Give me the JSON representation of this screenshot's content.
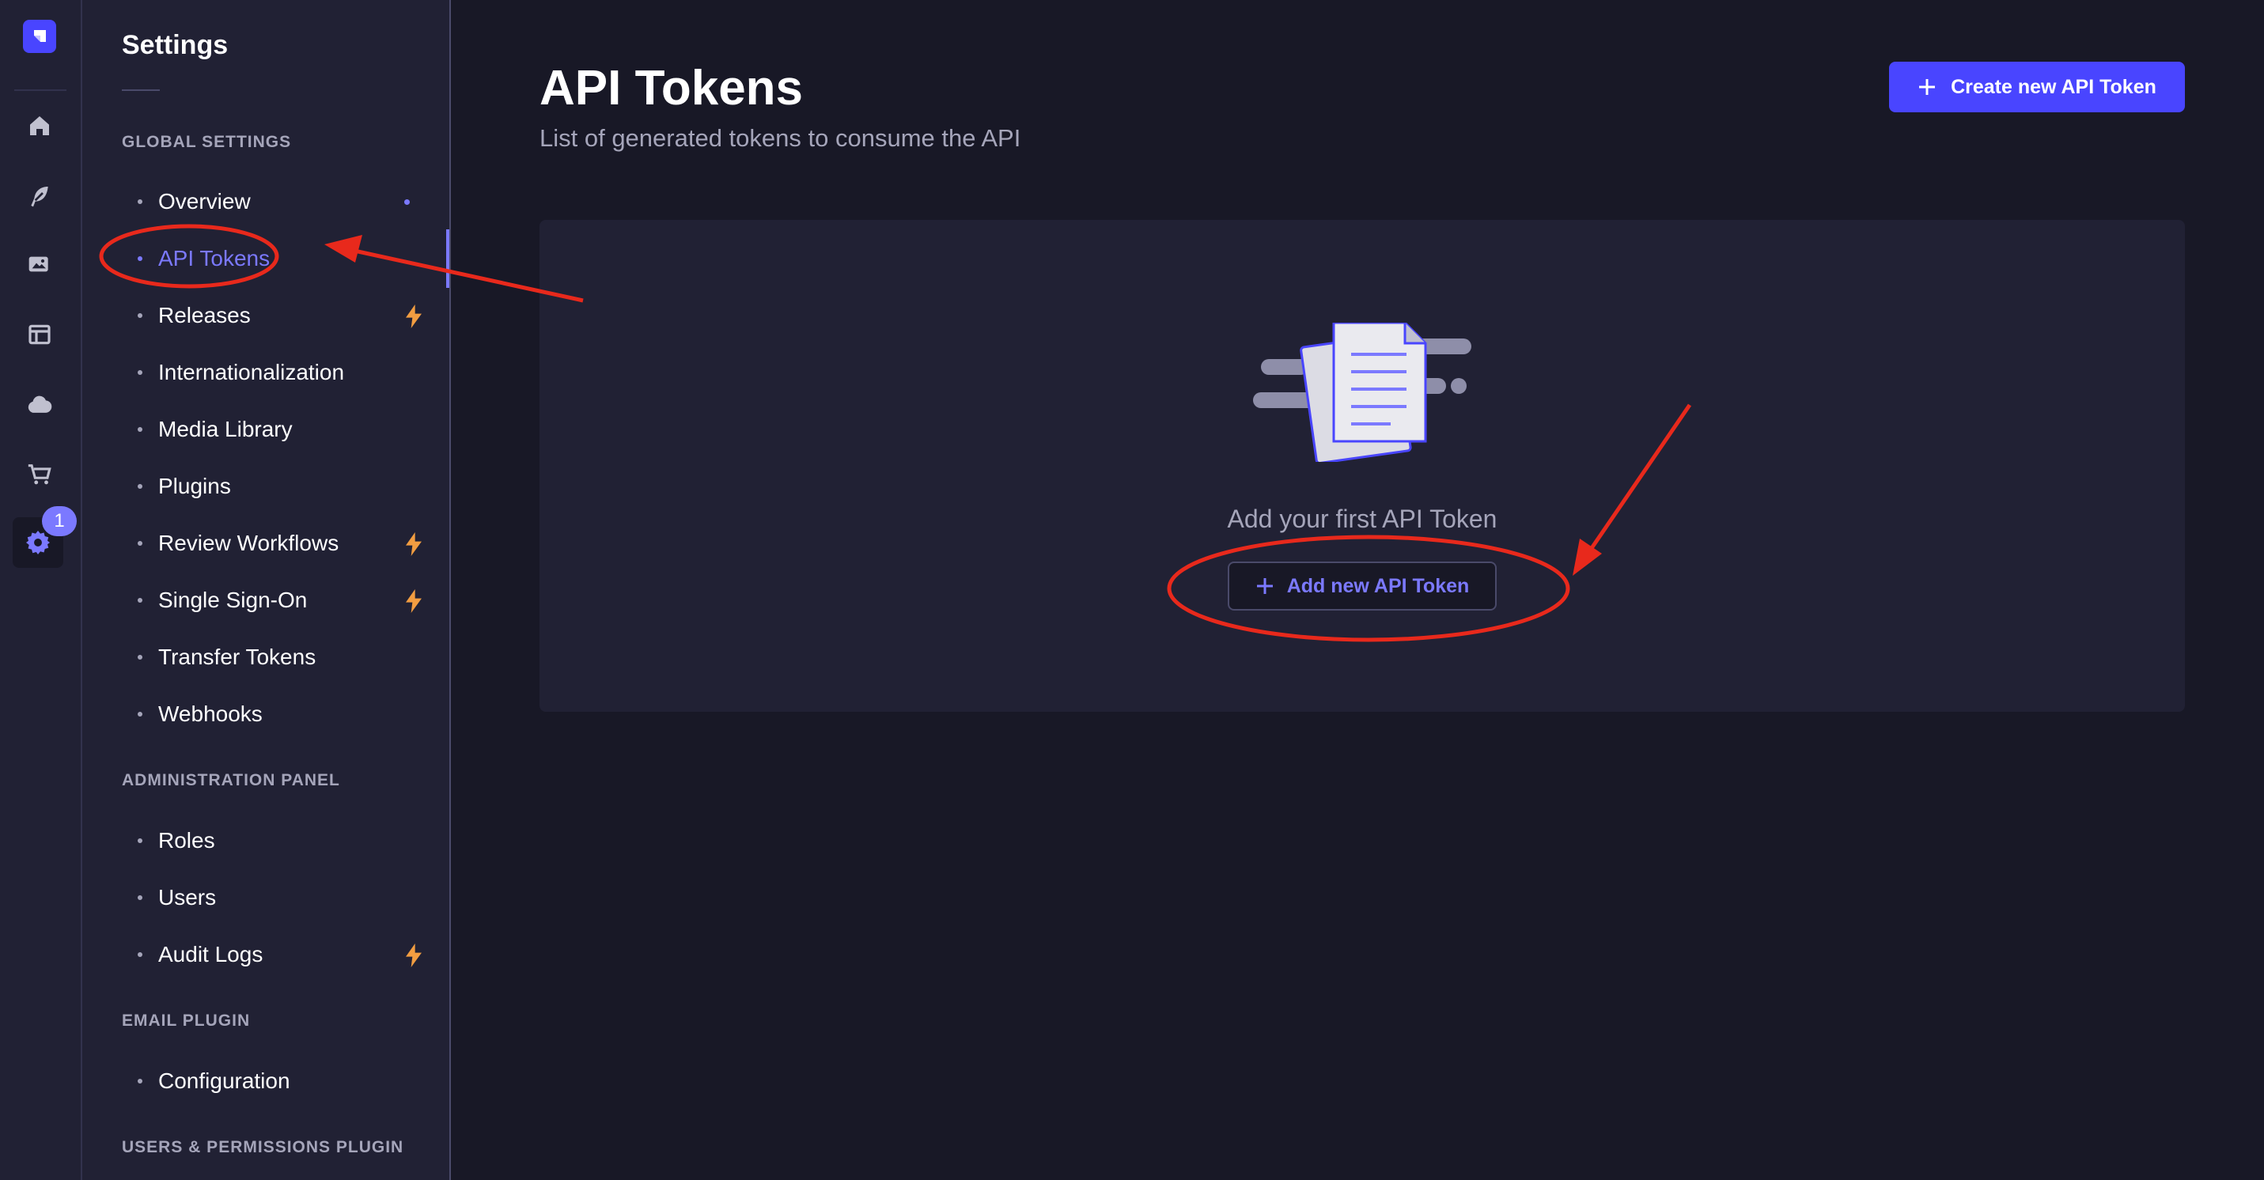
{
  "sidebar": {
    "title": "Settings",
    "badge_count": "1",
    "sections": [
      {
        "label": "GLOBAL SETTINGS",
        "items": [
          {
            "label": "Overview"
          },
          {
            "label": "API Tokens"
          },
          {
            "label": "Releases"
          },
          {
            "label": "Internationalization"
          },
          {
            "label": "Media Library"
          },
          {
            "label": "Plugins"
          },
          {
            "label": "Review Workflows"
          },
          {
            "label": "Single Sign-On"
          },
          {
            "label": "Transfer Tokens"
          },
          {
            "label": "Webhooks"
          }
        ]
      },
      {
        "label": "ADMINISTRATION PANEL",
        "items": [
          {
            "label": "Roles"
          },
          {
            "label": "Users"
          },
          {
            "label": "Audit Logs"
          }
        ]
      },
      {
        "label": "EMAIL PLUGIN",
        "items": [
          {
            "label": "Configuration"
          }
        ]
      },
      {
        "label": "USERS & PERMISSIONS PLUGIN",
        "items": []
      }
    ]
  },
  "header": {
    "title": "API Tokens",
    "subtitle": "List of generated tokens to consume the API",
    "create_button": "Create new API Token"
  },
  "empty_state": {
    "message": "Add your first API Token",
    "add_button": "Add new API Token"
  },
  "colors": {
    "background": "#181826",
    "panel": "#212134",
    "primary": "#4945ff",
    "accent": "#7b79ff",
    "muted": "#a5a5ba",
    "premium_bolt": "#f29d41",
    "annotation": "#e8291c"
  }
}
